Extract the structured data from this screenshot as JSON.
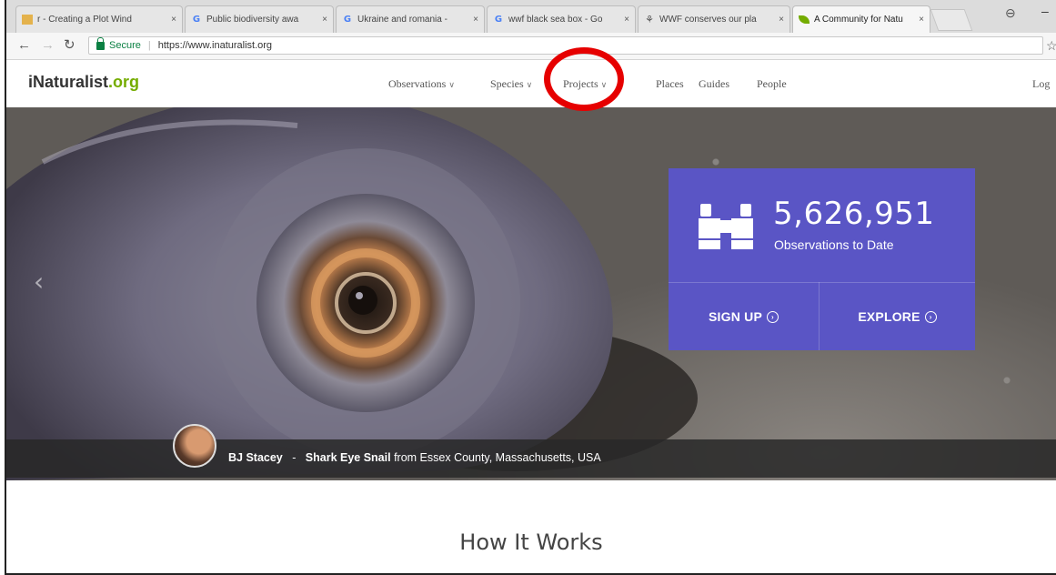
{
  "browser": {
    "tabs": [
      {
        "title": "r - Creating a Plot Wind",
        "icon": "doc-icon",
        "active": false
      },
      {
        "title": "Public biodiversity awa",
        "icon": "google-icon",
        "active": false
      },
      {
        "title": "Ukraine and romania -",
        "icon": "google-icon",
        "active": false
      },
      {
        "title": "wwf black sea box - Go",
        "icon": "google-icon",
        "active": false
      },
      {
        "title": "WWF conserves our pla",
        "icon": "wwf-icon",
        "active": false
      },
      {
        "title": "A Community for Natu",
        "icon": "leaf-icon",
        "active": true
      }
    ],
    "close_glyph": "×",
    "secure_label": "Secure",
    "url": "https://www.inaturalist.org"
  },
  "site": {
    "logo_main": "iNaturalist",
    "logo_suffix": ".org",
    "nav": [
      {
        "label": "Observations",
        "dropdown": true
      },
      {
        "label": "Species",
        "dropdown": true
      },
      {
        "label": "Projects",
        "dropdown": true
      },
      {
        "label": "Places",
        "dropdown": false
      },
      {
        "label": "Guides",
        "dropdown": false
      },
      {
        "label": "People",
        "dropdown": false
      }
    ],
    "login_label": "Log"
  },
  "hero": {
    "observations_count": "5,626,951",
    "observations_label": "Observations to Date",
    "signup_label": "SIGN UP",
    "explore_label": "EXPLORE",
    "photographer": "BJ Stacey",
    "separator": "-",
    "species": "Shark Eye Snail",
    "location_text": "from Essex County, Massachusetts, USA"
  },
  "how_it_works": {
    "title": "How It Works"
  },
  "colors": {
    "card": "#5a55c5",
    "logo_green": "#74ac00",
    "highlight": "#e60000"
  }
}
